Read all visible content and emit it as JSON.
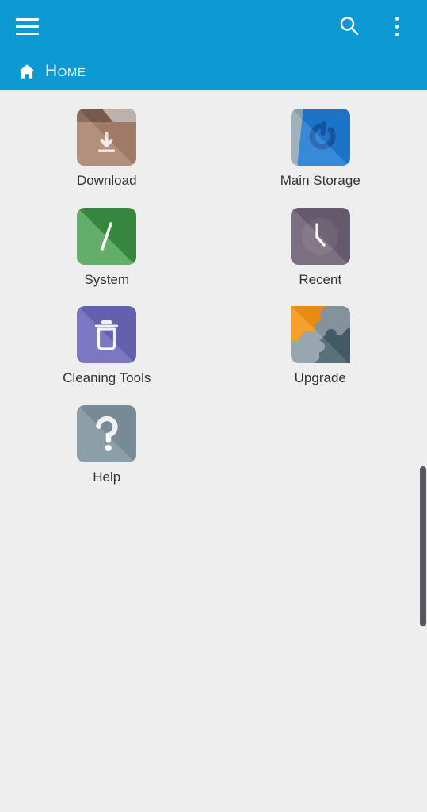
{
  "appbar": {
    "background_color": "#0d9ad2",
    "menu_icon": "hamburger-menu-icon",
    "search_icon": "search-icon",
    "overflow_icon": "more-vertical-icon"
  },
  "breadcrumb": {
    "home_icon": "home-icon",
    "label": "Home"
  },
  "content": {
    "background_color": "#eeeeee",
    "items": [
      {
        "label": "Download",
        "icon": "folder-download-icon",
        "color": "#a8826d"
      },
      {
        "label": "Main Storage",
        "icon": "device-storage-icon",
        "color": "#1e7bd4"
      },
      {
        "label": "System",
        "icon": "root-slash-icon",
        "color": "#3e9946"
      },
      {
        "label": "Recent",
        "icon": "clock-icon",
        "color": "#6b5f72"
      },
      {
        "label": "Cleaning Tools",
        "icon": "trash-can-icon",
        "color": "#6b66b8"
      },
      {
        "label": "Upgrade",
        "icon": "puzzle-piece-icon",
        "color": "#f59412"
      },
      {
        "label": "Help",
        "icon": "question-mark-icon",
        "color": "#7e939e"
      }
    ]
  },
  "scrollbar": {
    "thumb_color": "#58565e"
  }
}
